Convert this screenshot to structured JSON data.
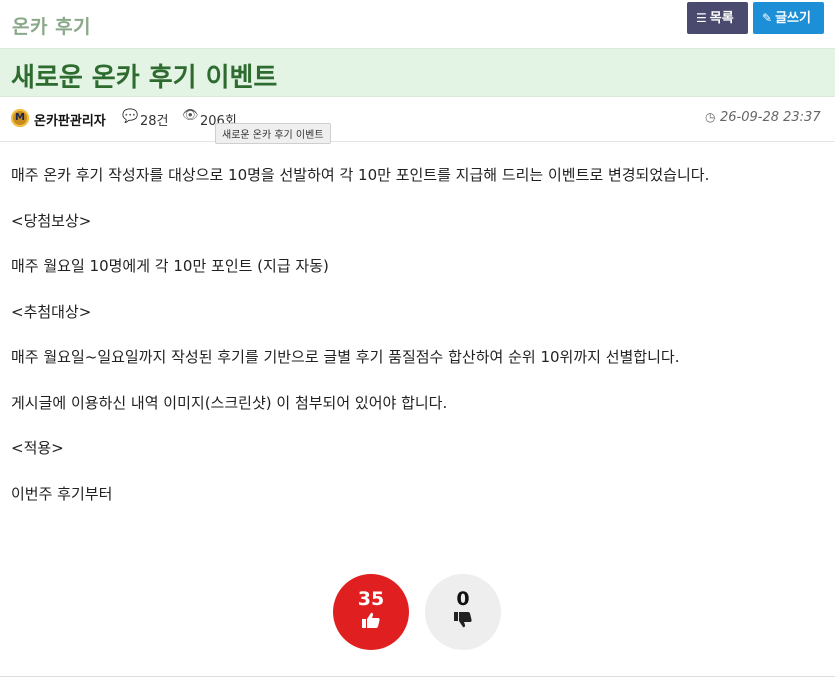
{
  "header": {
    "board_name": "온카 후기",
    "list_button": "목록",
    "write_button": "글쓰기"
  },
  "post": {
    "title": "새로운 온카 후기 이벤트",
    "author": "온카판관리자",
    "avatar_letter": "M",
    "comments": "28건",
    "views": "206회",
    "tooltip": "새로운 온카 후기 이벤트",
    "date": "26-09-28 23:37",
    "paragraphs": [
      "매주 온카 후기 작성자를 대상으로 10명을 선발하여 각 10만 포인트를 지급해 드리는 이벤트로 변경되었습니다.",
      "<당첨보상>",
      "매주 월요일 10명에게 각 10만 포인트 (지급 자동)",
      "<추첨대상>",
      "매주 월요일~일요일까지 작성된 후기를 기반으로 글별 후기 품질점수 합산하여 순위 10위까지 선별합니다.",
      "게시글에 이용하신 내역 이미지(스크린샷) 이 첨부되어 있어야 합니다.",
      "<적용>",
      "이번주 후기부터"
    ]
  },
  "votes": {
    "up": "35",
    "down": "0"
  },
  "icons": {
    "list": "list-icon",
    "write": "pencil-icon",
    "comment": "comment-icon",
    "view": "eye-icon",
    "clock": "clock-icon",
    "thumbs_up": "thumbs-up-icon",
    "thumbs_down": "thumbs-down-icon"
  },
  "colors": {
    "board_name": "#8aa88a",
    "title_bg": "#e3f4e4",
    "title_text": "#2e6b2f",
    "list_button": "#4a4a6e",
    "write_button": "#1d8fd6",
    "vote_up": "#e02020",
    "vote_down": "#eeeeee"
  }
}
